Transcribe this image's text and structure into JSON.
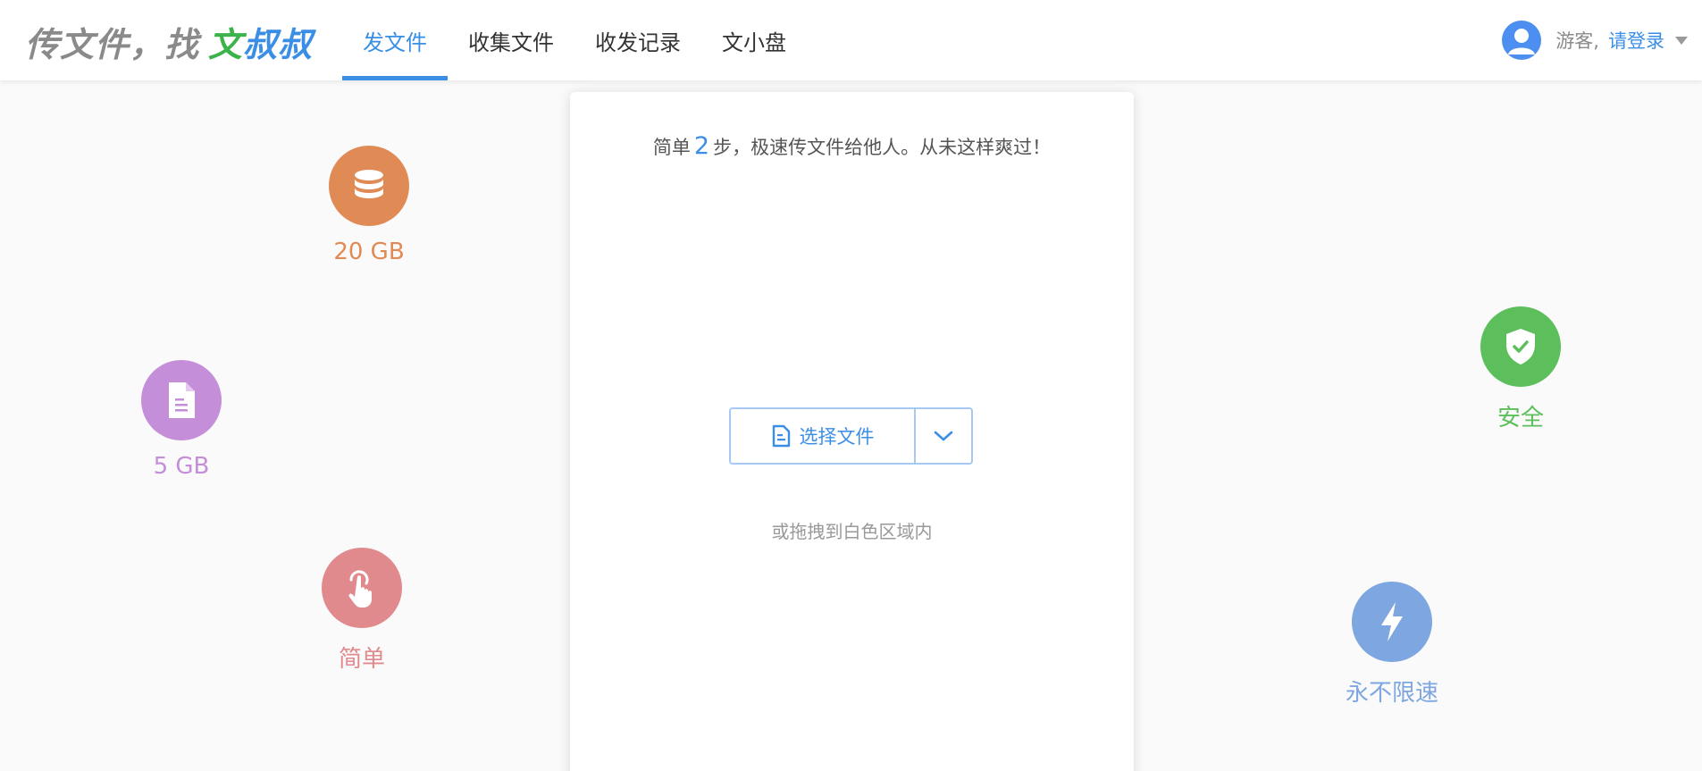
{
  "logo": {
    "part1": "传文件，找 ",
    "part2": "文",
    "part3": "叔叔"
  },
  "nav": {
    "items": [
      {
        "label": "发文件",
        "active": true
      },
      {
        "label": "收集文件",
        "active": false
      },
      {
        "label": "收发记录",
        "active": false
      },
      {
        "label": "文小盘",
        "active": false
      }
    ]
  },
  "user": {
    "guest_label": "游客,",
    "login_label": "请登录"
  },
  "features": {
    "storage": {
      "label": "20 GB",
      "color": "#e08a56",
      "icon": "database-icon"
    },
    "file_size": {
      "label": "5 GB",
      "color": "#c48ed8",
      "icon": "document-icon"
    },
    "simple": {
      "label": "简单",
      "color": "#e08a8e",
      "icon": "pointer-hand-icon"
    },
    "secure": {
      "label": "安全",
      "color": "#5cbf5c",
      "icon": "shield-check-icon"
    },
    "speed": {
      "label": "永不限速",
      "color": "#7ea6e0",
      "icon": "lightning-icon"
    }
  },
  "upload": {
    "tagline_prefix": "简单",
    "tagline_step": "2",
    "tagline_suffix": "步，极速传文件给他人。从未这样爽过！",
    "choose_label": "选择文件",
    "drag_hint": "或拖拽到白色区域内"
  },
  "colors": {
    "accent": "#3a8ee6",
    "logo_green": "#3bb34a"
  }
}
